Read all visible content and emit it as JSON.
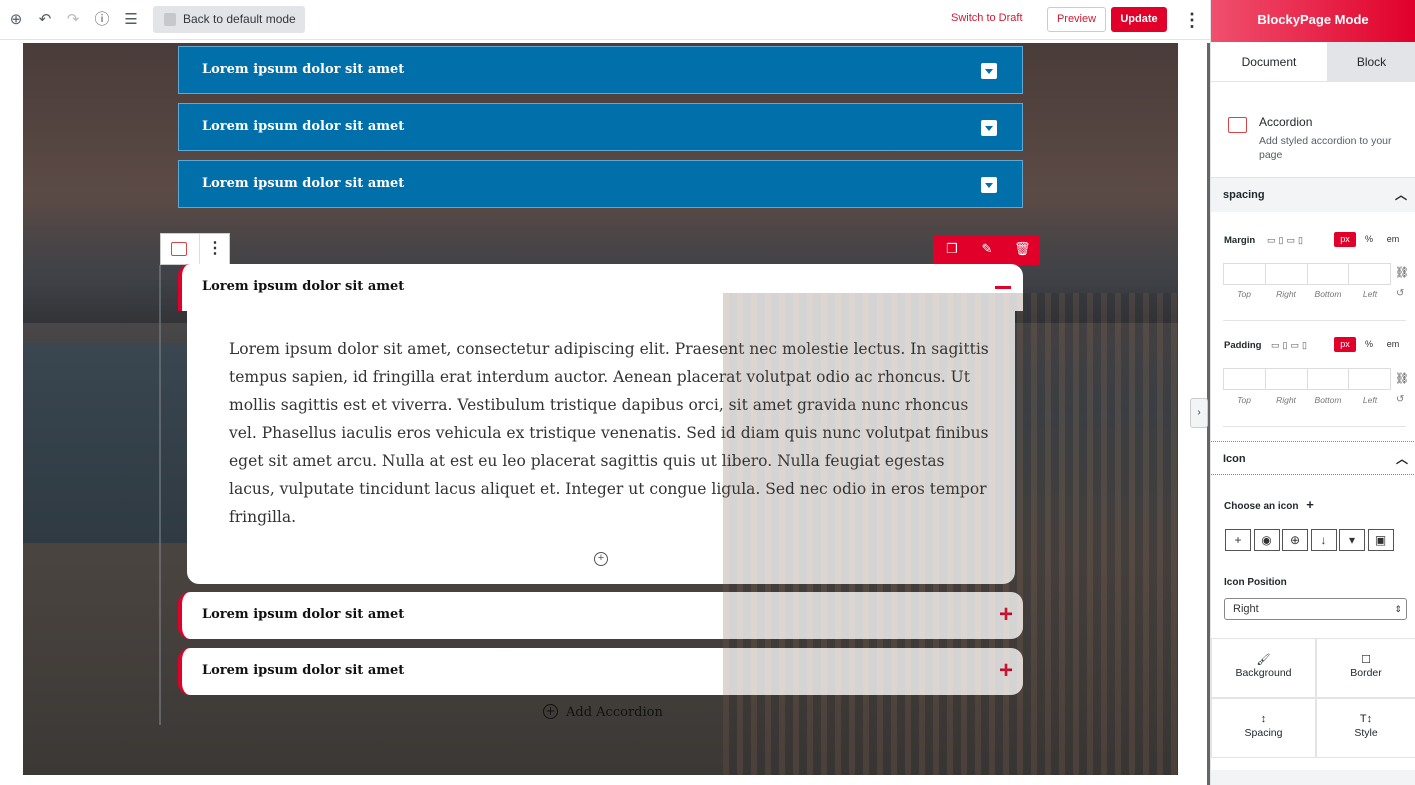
{
  "toolbar": {
    "back_label": "Back to default mode",
    "switch_draft": "Switch to Draft",
    "preview": "Preview",
    "update": "Update"
  },
  "canvas": {
    "blue_accordions": [
      "Lorem ipsum dolor sit amet",
      "Lorem ipsum dolor sit amet",
      "Lorem ipsum dolor sit amet"
    ],
    "open_accordion": {
      "title": "Lorem ipsum dolor sit amet",
      "body": "Lorem ipsum dolor sit amet, consectetur adipiscing elit. Praesent nec molestie lectus. In sagittis tempus sapien, id fringilla erat interdum auctor. Aenean placerat volutpat odio ac rhoncus. Ut mollis sagittis est et viverra. Vestibulum tristique dapibus orci, sit amet gravida nunc rhoncus vel. Phasellus iaculis eros vehicula ex tristique venenatis. Sed id diam quis nunc volutpat finibus eget sit amet arcu. Nulla at est eu leo placerat sagittis quis ut libero. Nulla feugiat egestas lacus, vulputate tincidunt lacus aliquet et. Integer ut congue ligula. Sed nec odio in eros tempor fringilla."
    },
    "closed_accordions": [
      "Lorem ipsum dolor sit amet",
      "Lorem ipsum dolor sit amet"
    ],
    "add_accordion": "Add Accordion"
  },
  "sidebar": {
    "title": "BlockyPage Mode",
    "tabs": [
      "Document",
      "Block"
    ],
    "block_name": "Accordion",
    "block_desc": "Add styled accordion to your page",
    "spacing_title": "spacing",
    "margin_label": "Margin",
    "padding_label": "Padding",
    "units": [
      "px",
      "%",
      "em"
    ],
    "sides": [
      "Top",
      "Right",
      "Bottom",
      "Left"
    ],
    "icon_title": "Icon",
    "choose_icon": "Choose an icon",
    "icon_position_label": "Icon Position",
    "icon_position_value": "Right",
    "buttons": [
      "Background",
      "Border",
      "Spacing",
      "Style"
    ]
  },
  "colors": {
    "accent": "#e0002a",
    "accordion_blue": "#006faa"
  }
}
